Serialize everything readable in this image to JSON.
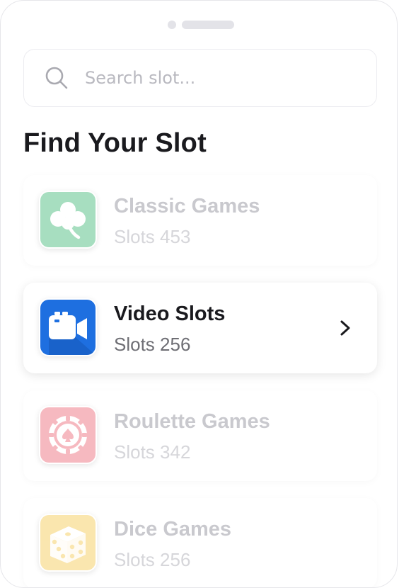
{
  "search": {
    "placeholder": "Search slot..."
  },
  "page_title": "Find Your Slot",
  "categories": [
    {
      "name": "Classic Games",
      "count": "Slots 453",
      "icon": "clover-icon",
      "color": "#2fb36a",
      "state": "dim"
    },
    {
      "name": "Video Slots",
      "count": "Slots 256",
      "icon": "video-camera-icon",
      "color": "#1e6fe0",
      "state": "active"
    },
    {
      "name": "Roulette Games",
      "count": "Slots 342",
      "icon": "casino-chip-icon",
      "color": "#ec5b6a",
      "state": "dim"
    },
    {
      "name": "Dice Games",
      "count": "Slots 256",
      "icon": "dice-icon",
      "color": "#f4c440",
      "state": "dim"
    }
  ]
}
